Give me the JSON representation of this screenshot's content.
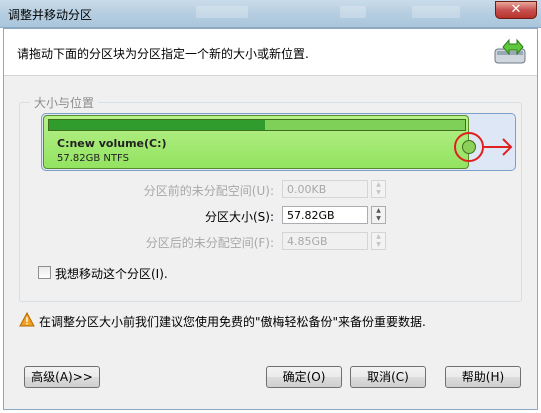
{
  "window": {
    "title": "调整并移动分区",
    "close_label": "✕"
  },
  "header": {
    "instruction": "请拖动下面的分区块为分区指定一个新的大小或新位置."
  },
  "group": {
    "legend": "大小与位置",
    "partition": {
      "name": "C:new volume(C:)",
      "size_text": "57.82GB NTFS",
      "used_fraction": 0.52
    },
    "rows": {
      "free_before": {
        "label": "分区前的未分配空间(U):",
        "value": "0.00KB"
      },
      "size": {
        "label": "分区大小(S):",
        "value": "57.82GB"
      },
      "free_after": {
        "label": "分区后的未分配空间(F):",
        "value": "4.85GB"
      }
    },
    "move_checkbox": {
      "label": "我想移动这个分区(I).",
      "checked": false
    }
  },
  "warning": {
    "text": "在调整分区大小前我们建议您使用免费的\"傲梅轻松备份\"来备份重要数据."
  },
  "buttons": {
    "advanced": "高级(A)>>",
    "ok": "确定(O)",
    "cancel": "取消(C)",
    "help": "帮助(H)"
  },
  "colors": {
    "partition_green": "#93e360",
    "used_green": "#2f9c2d",
    "handle_red": "#e02020"
  }
}
